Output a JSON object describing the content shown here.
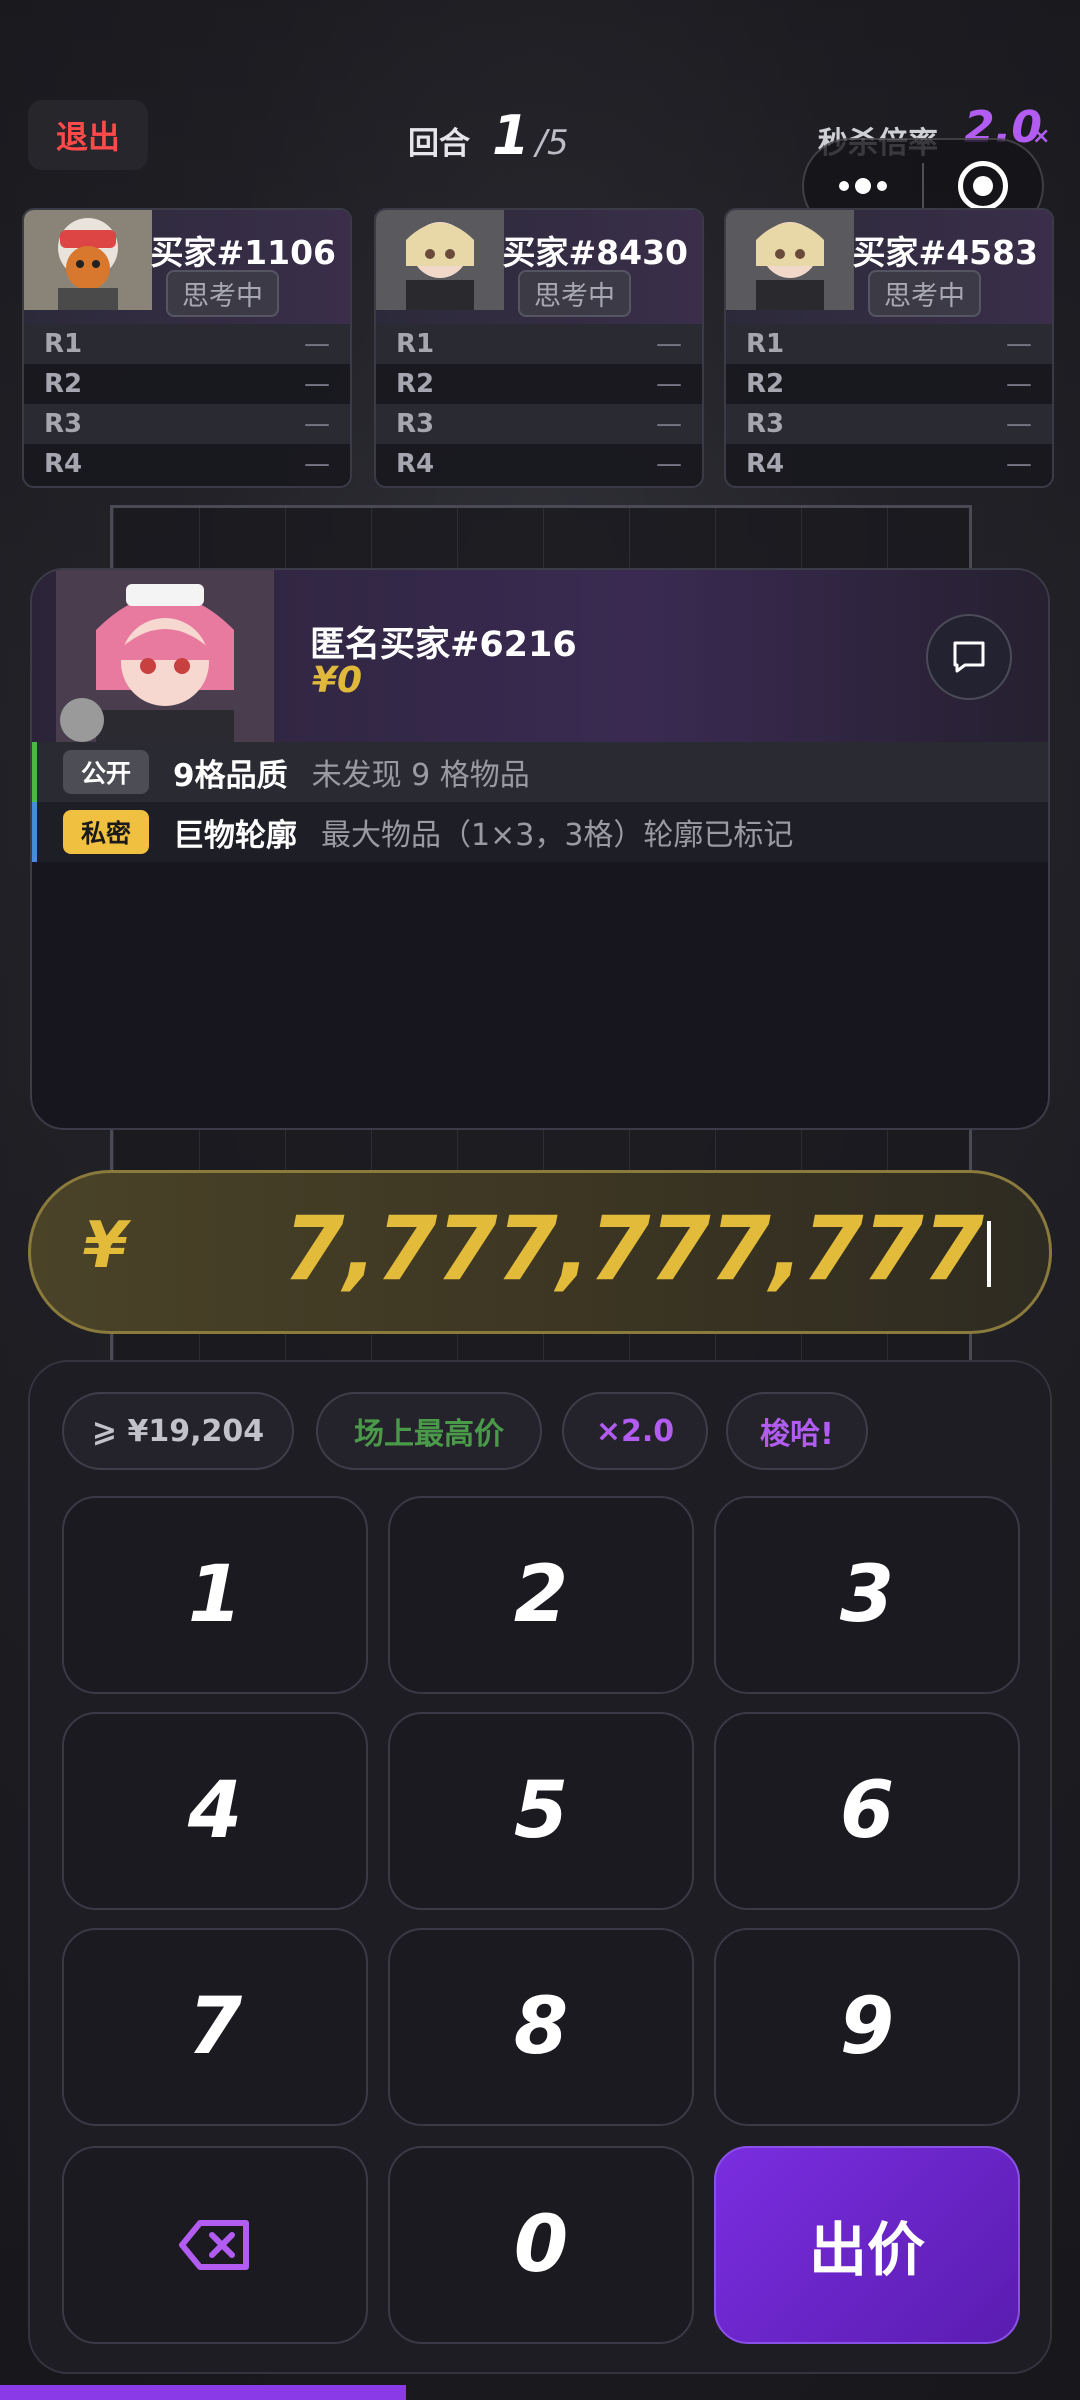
{
  "topbar": {
    "exit": "退出",
    "round_label": "回合",
    "round_current": "1",
    "round_total": "/5",
    "rate_label": "秒杀倍率",
    "rate_value": "2.0",
    "rate_suffix": "×"
  },
  "buyers": [
    {
      "name": "买家#1106",
      "status": "思考中",
      "rounds": [
        {
          "label": "R1",
          "value": "—"
        },
        {
          "label": "R2",
          "value": "—"
        },
        {
          "label": "R3",
          "value": "—"
        },
        {
          "label": "R4",
          "value": "—"
        }
      ]
    },
    {
      "name": "买家#8430",
      "status": "思考中",
      "rounds": [
        {
          "label": "R1",
          "value": "—"
        },
        {
          "label": "R2",
          "value": "—"
        },
        {
          "label": "R3",
          "value": "—"
        },
        {
          "label": "R4",
          "value": "—"
        }
      ]
    },
    {
      "name": "买家#4583",
      "status": "思考中",
      "rounds": [
        {
          "label": "R1",
          "value": "—"
        },
        {
          "label": "R2",
          "value": "—"
        },
        {
          "label": "R3",
          "value": "—"
        },
        {
          "label": "R4",
          "value": "—"
        }
      ]
    }
  ],
  "main_buyer": {
    "name": "匿名买家#6216",
    "money": "¥0",
    "public_tag": "公开",
    "public_title": "9格品质",
    "public_desc": "未发现 9 格物品",
    "private_tag": "私密",
    "private_title": "巨物轮廓",
    "private_desc": "最大物品（1×3，3格）轮廓已标记"
  },
  "bid": {
    "currency": "¥",
    "amount": "7,777,777,777"
  },
  "chips": {
    "min": "⩾ ¥19,204",
    "highest": "场上最高价",
    "multiplier": "×2.0",
    "showhand": "梭哈!"
  },
  "keys": {
    "k1": "1",
    "k2": "2",
    "k3": "3",
    "k4": "4",
    "k5": "5",
    "k6": "6",
    "k7": "7",
    "k8": "8",
    "k9": "9",
    "k0": "0",
    "bid": "出价"
  },
  "colors": {
    "accent_purple": "#8a3ae6",
    "gold": "#e3bb3a",
    "exit_red": "#ff4a4a",
    "public_green": "#4cb84c",
    "private_blue": "#4a8ad8"
  },
  "icons": [
    "more-dots-icon",
    "target-icon",
    "chat-icon",
    "backspace-icon"
  ]
}
